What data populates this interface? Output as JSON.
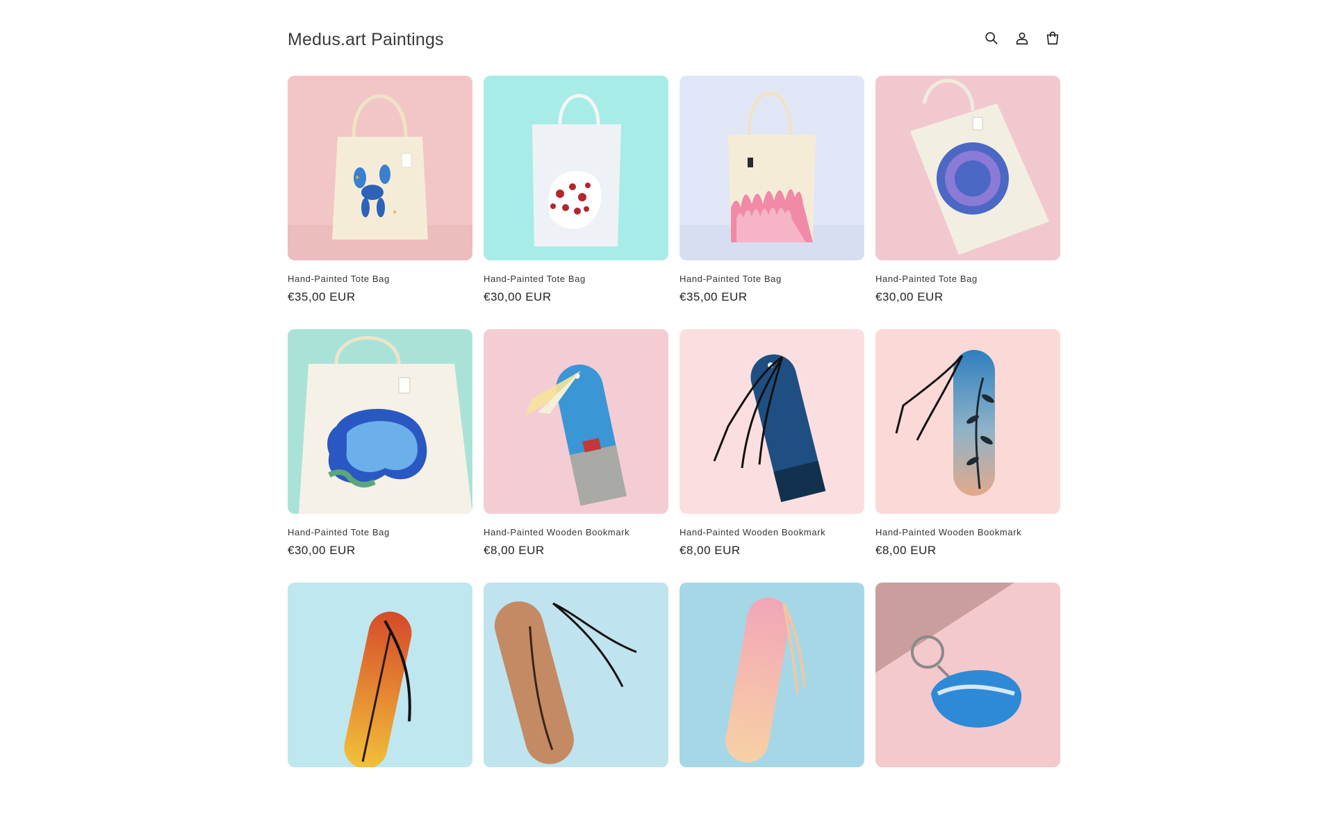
{
  "header": {
    "brand": "Medus.art Paintings",
    "icons": [
      "search-icon",
      "account-icon",
      "cart-icon"
    ]
  },
  "products": [
    {
      "title": "Hand-Painted Tote Bag",
      "price": "€35,00 EUR",
      "art": "tote-balloon-dog"
    },
    {
      "title": "Hand-Painted Tote Bag",
      "price": "€30,00 EUR",
      "art": "tote-leopard"
    },
    {
      "title": "Hand-Painted Tote Bag",
      "price": "€35,00 EUR",
      "art": "tote-flames"
    },
    {
      "title": "Hand-Painted Tote Bag",
      "price": "€30,00 EUR",
      "art": "tote-attract-dont-chase"
    },
    {
      "title": "Hand-Painted Tote Bag",
      "price": "€30,00 EUR",
      "art": "tote-free-your-mind"
    },
    {
      "title": "Hand-Painted Wooden Bookmark",
      "price": "€8,00 EUR",
      "art": "bookmark-sky-van"
    },
    {
      "title": "Hand-Painted Wooden Bookmark",
      "price": "€8,00 EUR",
      "art": "bookmark-night-sky"
    },
    {
      "title": "Hand-Painted Wooden Bookmark",
      "price": "€8,00 EUR",
      "art": "bookmark-leaves-sunset"
    },
    {
      "title": "",
      "price": "",
      "art": "bookmark-orange-leaves"
    },
    {
      "title": "",
      "price": "",
      "art": "bookmark-wood-leaves"
    },
    {
      "title": "",
      "price": "",
      "art": "bookmark-pink-sky"
    },
    {
      "title": "",
      "price": "",
      "art": "keychain-sea"
    }
  ],
  "colors": {
    "pink_bg": "#f2c6c6",
    "mint_bg": "#a7ece6",
    "lavender_bg": "#e1e6f7",
    "tote_cream": "#f5ecd8",
    "blue_paint": "#2c63b8"
  }
}
